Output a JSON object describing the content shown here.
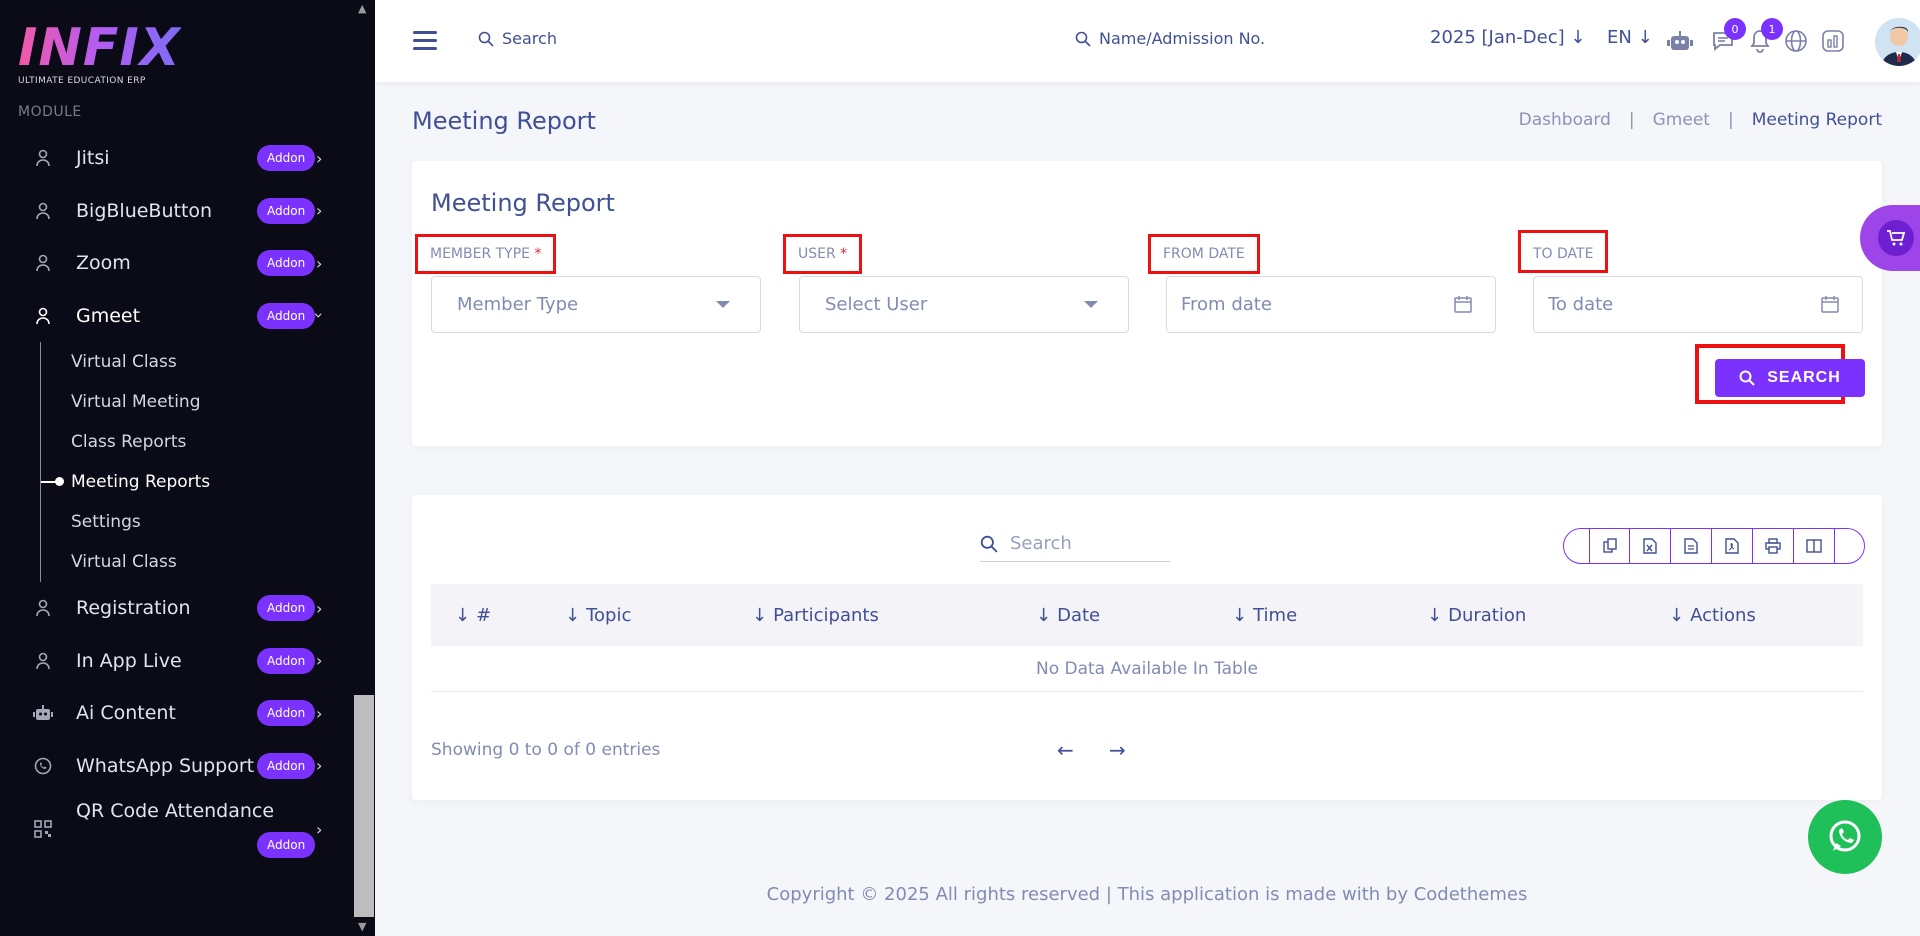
{
  "sidebar": {
    "logo_text": "INFIX",
    "logo_sub": "ULTIMATE EDUCATION ERP",
    "module_label": "MODULE",
    "addon_label": "Addon",
    "items": [
      {
        "label": "Jitsi",
        "icon": "user-icon"
      },
      {
        "label": "BigBlueButton",
        "icon": "user-icon"
      },
      {
        "label": "Zoom",
        "icon": "user-icon"
      },
      {
        "label": "Gmeet",
        "icon": "user-icon"
      },
      {
        "label": "Registration",
        "icon": "user-icon"
      },
      {
        "label": "In App Live",
        "icon": "user-icon"
      },
      {
        "label": "Ai Content",
        "icon": "robot-icon"
      },
      {
        "label": "WhatsApp Support",
        "icon": "whatsapp-icon"
      },
      {
        "label": "QR Code Attendance",
        "icon": "qr-icon"
      }
    ],
    "gmeet_sub": [
      "Virtual Class",
      "Virtual Meeting",
      "Class Reports",
      "Meeting Reports",
      "Settings",
      "Virtual Class"
    ]
  },
  "header": {
    "search_label": "Search",
    "student_search_label": "Name/Admission No.",
    "year": "2025 [Jan-Dec]",
    "lang": "EN",
    "messages_count": "0",
    "notifications_count": "1"
  },
  "page": {
    "title": "Meeting Report",
    "breadcrumb": [
      "Dashboard",
      "Gmeet",
      "Meeting Report"
    ],
    "separator": "|"
  },
  "filter": {
    "title": "Meeting Report",
    "member_type_label": "MEMBER TYPE",
    "user_label": "USER",
    "from_label": "FROM DATE",
    "to_label": "TO DATE",
    "required_mark": "*",
    "member_type_value": "Member Type",
    "user_value": "Select User",
    "from_placeholder": "From date",
    "to_placeholder": "To date",
    "search_button": "SEARCH"
  },
  "table": {
    "search_placeholder": "Search",
    "columns": [
      "#",
      "Topic",
      "Participants",
      "Date",
      "Time",
      "Duration",
      "Actions"
    ],
    "empty_text": "No Data Available In Table",
    "showing": "Showing 0 to 0 of 0 entries",
    "export_buttons": [
      "copy-icon",
      "excel-icon",
      "csv-icon",
      "pdf-icon",
      "print-icon",
      "columns-icon"
    ]
  },
  "footer": {
    "text": "Copyright © 2025 All rights reserved | This application is made with by Codethemes"
  },
  "colors": {
    "accent": "#7c32ff",
    "sidebar_bg": "#0b0b17",
    "text": "#415094",
    "highlight": "#ee1111",
    "whatsapp": "#1fbf5a"
  }
}
